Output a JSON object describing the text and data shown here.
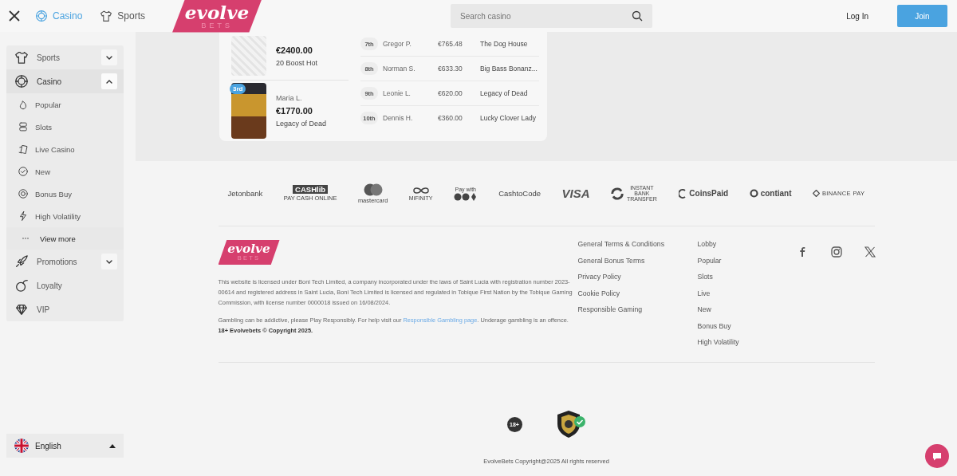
{
  "header": {
    "tabs": [
      {
        "label": "Casino",
        "kind": "casino",
        "selected": true
      },
      {
        "label": "Sports",
        "kind": "sports",
        "selected": false
      }
    ],
    "logo": {
      "text": "evolve",
      "subtext": "BETS"
    },
    "search": {
      "placeholder": "Search casino"
    },
    "login": "Log In",
    "join": "Join"
  },
  "sidebar": {
    "items": [
      {
        "label": "Sports",
        "kind": "sports",
        "expandable": true,
        "expanded": false,
        "selected": false
      },
      {
        "label": "Casino",
        "kind": "casino",
        "expandable": true,
        "expanded": true,
        "selected": true,
        "children": [
          {
            "label": "Popular",
            "kind": "flame"
          },
          {
            "label": "Slots",
            "kind": "slots"
          },
          {
            "label": "Live Casino",
            "kind": "cards"
          },
          {
            "label": "New",
            "kind": "badge"
          },
          {
            "label": "Bonus Buy",
            "kind": "chip"
          },
          {
            "label": "High Volatility",
            "kind": "bolt"
          },
          {
            "label": "View more",
            "kind": "more"
          }
        ]
      },
      {
        "label": "Promotions",
        "kind": "rocket",
        "expandable": true,
        "expanded": false,
        "selected": false
      },
      {
        "label": "Loyalty",
        "kind": "bomb",
        "expandable": false,
        "selected": false
      },
      {
        "label": "VIP",
        "kind": "diamond",
        "expandable": false,
        "selected": false
      }
    ],
    "language": "English"
  },
  "leaderboard": {
    "top": [
      {
        "amount": "€2400.00",
        "game": "20 Boost Hot",
        "kind": "sketch"
      },
      {
        "badge": "3rd",
        "player": "Maria L.",
        "amount": "€1770.00",
        "game": "Legacy of Dead",
        "kind": "gold"
      }
    ],
    "rows": [
      {
        "rank": "7th",
        "player": "Gregor P.",
        "amount": "€765.48",
        "game": "The Dog House"
      },
      {
        "rank": "8th",
        "player": "Norman S.",
        "amount": "€633.30",
        "game": "Big Bass Bonanz..."
      },
      {
        "rank": "9th",
        "player": "Leonie L.",
        "amount": "€620.00",
        "game": "Legacy of Dead"
      },
      {
        "rank": "10th",
        "player": "Dennis H.",
        "amount": "€360.00",
        "game": "Lucky Clover Lady"
      }
    ]
  },
  "payments": [
    {
      "text": "Jetonbank",
      "kind": "plain"
    },
    {
      "text": "CASHlib",
      "sub": "PAY CASH ONLINE",
      "kind": "boxed"
    },
    {
      "text": "mastercard",
      "kind": "circles"
    },
    {
      "text": "MiFINITY",
      "kind": "infinity"
    },
    {
      "text": "Pay with",
      "kind": "crypto"
    },
    {
      "text": "CashtoCode",
      "kind": "plain"
    },
    {
      "text": "VISA",
      "kind": "visa"
    },
    {
      "text": "INSTANT BANK TRANSFER",
      "kind": "transfer"
    },
    {
      "text": "CoinsPaid",
      "kind": "coin"
    },
    {
      "text": "contiant",
      "kind": "ring"
    },
    {
      "text": "BINANCE PAY",
      "kind": "binance"
    }
  ],
  "footer": {
    "logo": {
      "text": "evolve",
      "subtext": "BETS"
    },
    "license": "This website is licensed under Boni Tech Limited, a company incorporated under the laws of Saint Lucia with registration number 2023-00614 and registered address in Saint Lucia, Boni Tech Limited is licensed and regulated in Tobique First Nation by the Tobique Gaming Commission, with license number 0000018 issued on 16/08/2024.",
    "gambling_before": "Gambling can be addictive, please Play Responsibly. For help visit our ",
    "gambling_link": "Responsible Gambling page",
    "gambling_after": ". Underage gambling is an offence. **18+ Evolvebets © Copyright 2025.**",
    "links": [
      "General Terms & Conditions",
      "General Bonus Terms",
      "Privacy Policy",
      "Cookie Policy",
      "Responsible Gaming"
    ],
    "casino_links": [
      "Lobby",
      "Popular",
      "Slots",
      "Live",
      "New",
      "Bonus Buy",
      "High Volatility"
    ],
    "social": [
      {
        "kind": "facebook"
      },
      {
        "kind": "instagram"
      },
      {
        "kind": "x"
      }
    ],
    "age_badge": "18+",
    "copyright": "EvolveBets Copyright@2025 All rights reserved"
  }
}
